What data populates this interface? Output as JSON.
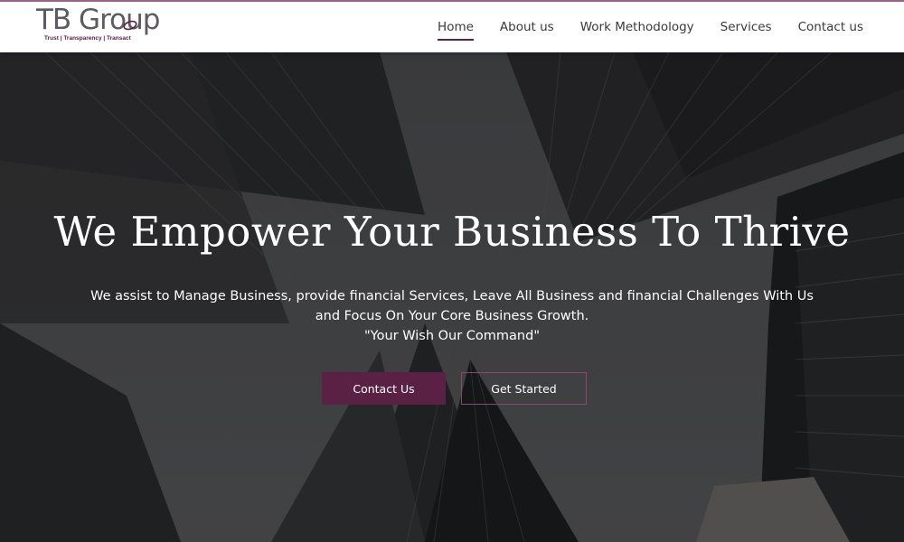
{
  "brand": {
    "logo_main": "TB Group",
    "logo_tagline": "Trust | Transparency | Transact",
    "accent_color": "#5a2145"
  },
  "nav": {
    "items": [
      {
        "label": "Home",
        "active": true
      },
      {
        "label": "About us",
        "active": false
      },
      {
        "label": "Work Methodology",
        "active": false
      },
      {
        "label": "Services",
        "active": false
      },
      {
        "label": "Contact us",
        "active": false
      }
    ]
  },
  "hero": {
    "title": "We Empower Your Business To Thrive",
    "description": "We assist to Manage Business, provide financial Services, Leave All Business and financial Challenges With Us and Focus On Your Core Business Growth.",
    "quote": "\"Your Wish Our Command\"",
    "primary_button": "Contact Us",
    "secondary_button": "Get Started"
  }
}
